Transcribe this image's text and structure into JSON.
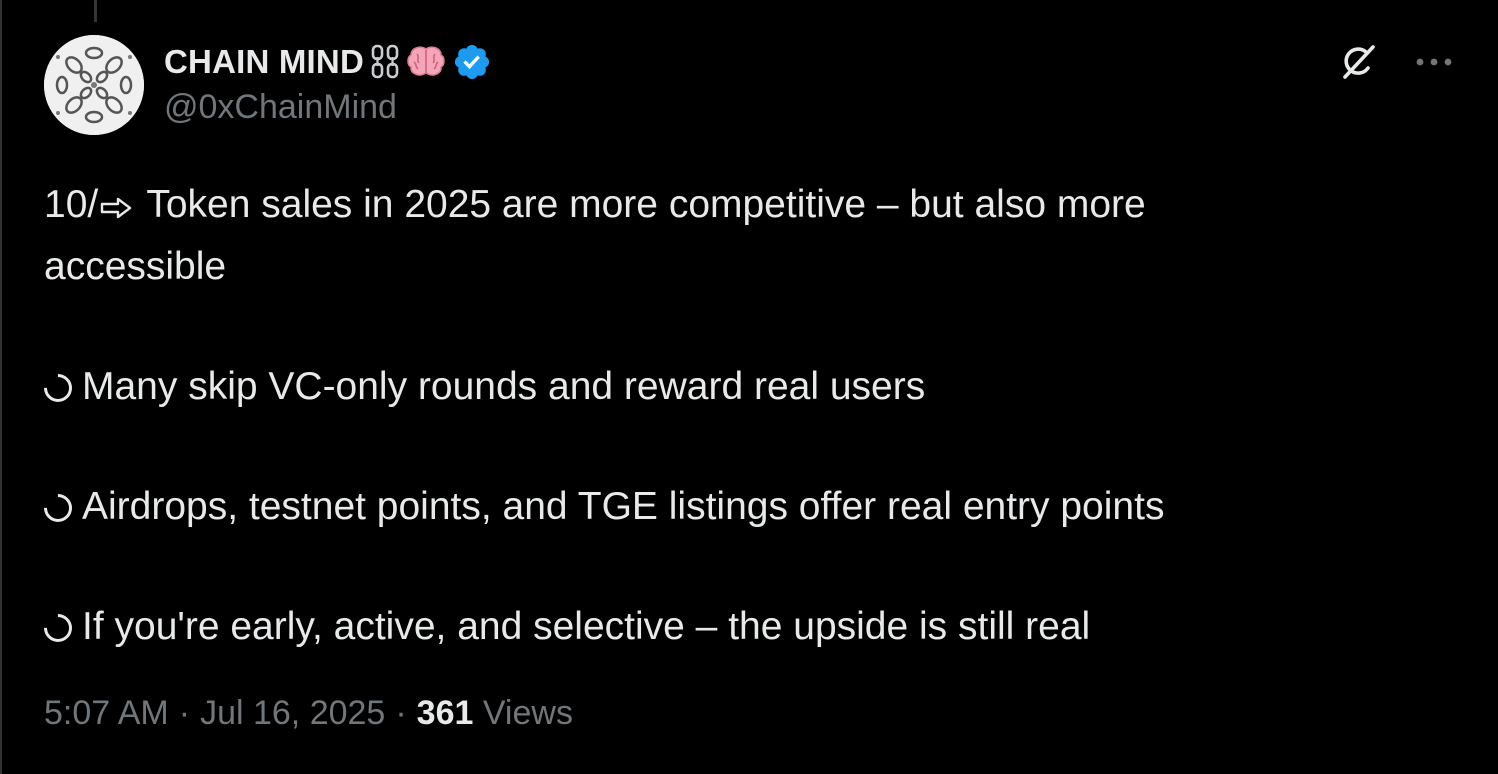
{
  "tweet": {
    "author": {
      "display_name": "CHAIN MIND",
      "name_emojis": [
        "chain-emoji",
        "brain-emoji"
      ],
      "verified": true,
      "handle": "@0xChainMind"
    },
    "text": {
      "intro_prefix": "10/",
      "intro_rest": " Token sales in 2025 are more competitive – but also more",
      "intro_line2": "accessible",
      "bullets": [
        "Many skip VC-only rounds and reward real users",
        "Airdrops, testnet points, and TGE listings offer real entry points",
        "If you're early, active, and selective – the upside is still real"
      ]
    },
    "meta": {
      "time": "5:07 AM",
      "separator": "·",
      "date": "Jul 16, 2025",
      "views_count": "361",
      "views_label": "Views"
    }
  },
  "icons": {
    "grok": "grok-icon",
    "more": "more-icon",
    "verified": "verified-badge-icon"
  },
  "colors": {
    "background": "#000000",
    "text_primary": "#e7e9ea",
    "text_secondary": "#71767b",
    "verified_blue": "#1d9bf0",
    "brain_pink": "#f4a6b8"
  }
}
